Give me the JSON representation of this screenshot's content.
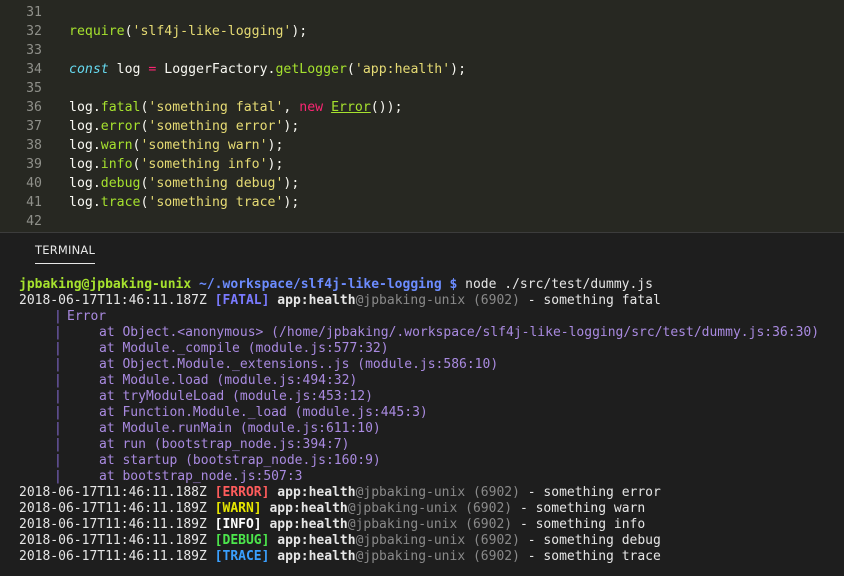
{
  "editor": {
    "lines": [
      {
        "num": "31",
        "tokens": []
      },
      {
        "num": "32",
        "tokens": [
          {
            "t": "require",
            "c": "t-fn"
          },
          {
            "t": "("
          },
          {
            "t": "'slf4j-like-logging'",
            "c": "t-str"
          },
          {
            "t": ");"
          }
        ]
      },
      {
        "num": "33",
        "tokens": []
      },
      {
        "num": "34",
        "tokens": [
          {
            "t": "const",
            "c": "t-kw"
          },
          {
            "t": " log "
          },
          {
            "t": "=",
            "c": "t-op"
          },
          {
            "t": " LoggerFactory."
          },
          {
            "t": "getLogger",
            "c": "t-fn"
          },
          {
            "t": "("
          },
          {
            "t": "'app:health'",
            "c": "t-str"
          },
          {
            "t": ");"
          }
        ]
      },
      {
        "num": "35",
        "tokens": []
      },
      {
        "num": "36",
        "tokens": [
          {
            "t": "log."
          },
          {
            "t": "fatal",
            "c": "t-fn"
          },
          {
            "t": "("
          },
          {
            "t": "'something fatal'",
            "c": "t-str"
          },
          {
            "t": ", "
          },
          {
            "t": "new",
            "c": "t-op"
          },
          {
            "t": " "
          },
          {
            "t": "Error",
            "c": "t-cls"
          },
          {
            "t": "());"
          }
        ]
      },
      {
        "num": "37",
        "tokens": [
          {
            "t": "log."
          },
          {
            "t": "error",
            "c": "t-fn"
          },
          {
            "t": "("
          },
          {
            "t": "'something error'",
            "c": "t-str"
          },
          {
            "t": ");"
          }
        ]
      },
      {
        "num": "38",
        "tokens": [
          {
            "t": "log."
          },
          {
            "t": "warn",
            "c": "t-fn"
          },
          {
            "t": "("
          },
          {
            "t": "'something warn'",
            "c": "t-str"
          },
          {
            "t": ");"
          }
        ]
      },
      {
        "num": "39",
        "tokens": [
          {
            "t": "log."
          },
          {
            "t": "info",
            "c": "t-fn"
          },
          {
            "t": "("
          },
          {
            "t": "'something info'",
            "c": "t-str"
          },
          {
            "t": ");"
          }
        ]
      },
      {
        "num": "40",
        "tokens": [
          {
            "t": "log."
          },
          {
            "t": "debug",
            "c": "t-fn"
          },
          {
            "t": "("
          },
          {
            "t": "'something debug'",
            "c": "t-str"
          },
          {
            "t": ");"
          }
        ]
      },
      {
        "num": "41",
        "tokens": [
          {
            "t": "log."
          },
          {
            "t": "trace",
            "c": "t-fn"
          },
          {
            "t": "("
          },
          {
            "t": "'something trace'",
            "c": "t-str"
          },
          {
            "t": ");"
          }
        ]
      },
      {
        "num": "42",
        "tokens": []
      }
    ]
  },
  "panel": {
    "tab_label": "TERMINAL"
  },
  "terminal": {
    "prompt": {
      "user_host": "jpbaking@jpbaking-unix",
      "path": "~/.workspace/slf4j-like-logging $",
      "command": " node ./src/test/dummy.js"
    },
    "fatal_line": {
      "timestamp": "2018-06-17T11:46:11.187Z",
      "level": "[FATAL]",
      "logger": "app:health",
      "host": "@jpbaking-unix (6902)",
      "message": " - something fatal"
    },
    "error_header": "Error",
    "stack": [
      "at Object.<anonymous> (/home/jpbaking/.workspace/slf4j-like-logging/src/test/dummy.js:36:30)",
      "at Module._compile (module.js:577:32)",
      "at Object.Module._extensions..js (module.js:586:10)",
      "at Module.load (module.js:494:32)",
      "at tryModuleLoad (module.js:453:12)",
      "at Function.Module._load (module.js:445:3)",
      "at Module.runMain (module.js:611:10)",
      "at run (bootstrap_node.js:394:7)",
      "at startup (bootstrap_node.js:160:9)",
      "at bootstrap_node.js:507:3"
    ],
    "log_lines": [
      {
        "timestamp": "2018-06-17T11:46:11.188Z",
        "level": "[ERROR]",
        "cls": "c-error",
        "logger": "app:health",
        "host": "@jpbaking-unix (6902)",
        "message": " - something error"
      },
      {
        "timestamp": "2018-06-17T11:46:11.189Z",
        "level": "[WARN]",
        "cls": "c-warn",
        "logger": "app:health",
        "host": "@jpbaking-unix (6902)",
        "message": " - something warn"
      },
      {
        "timestamp": "2018-06-17T11:46:11.189Z",
        "level": "[INFO]",
        "cls": "c-info",
        "logger": "app:health",
        "host": "@jpbaking-unix (6902)",
        "message": " - something info"
      },
      {
        "timestamp": "2018-06-17T11:46:11.189Z",
        "level": "[DEBUG]",
        "cls": "c-debug",
        "logger": "app:health",
        "host": "@jpbaking-unix (6902)",
        "message": " - something debug"
      },
      {
        "timestamp": "2018-06-17T11:46:11.189Z",
        "level": "[TRACE]",
        "cls": "c-trace",
        "logger": "app:health",
        "host": "@jpbaking-unix (6902)",
        "message": " - something trace"
      }
    ]
  }
}
